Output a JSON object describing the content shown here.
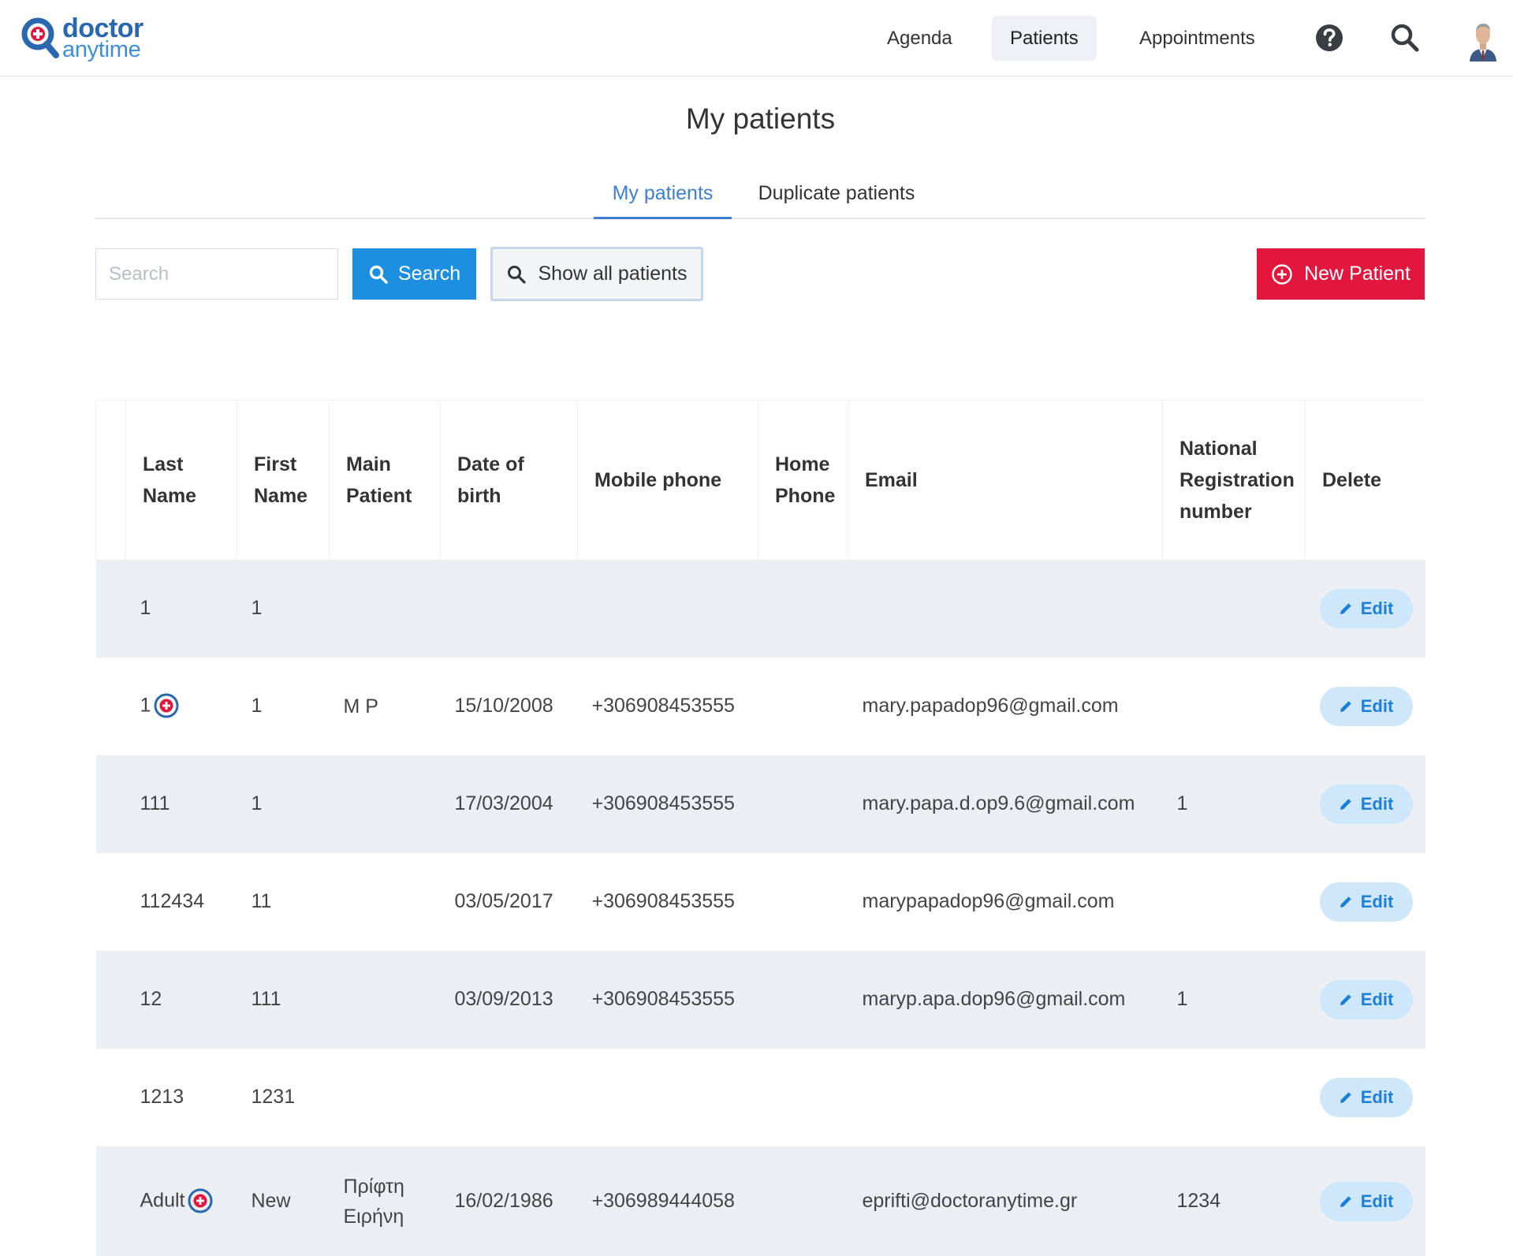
{
  "app": {
    "logo_word1": "doctor",
    "logo_word2": "anytime"
  },
  "nav": {
    "agenda": "Agenda",
    "patients": "Patients",
    "appointments": "Appointments",
    "active": "Patients"
  },
  "page": {
    "title": "My patients"
  },
  "tabs": [
    {
      "label": "My patients",
      "active": true
    },
    {
      "label": "Duplicate patients",
      "active": false
    }
  ],
  "toolbar": {
    "search_placeholder": "Search",
    "search_value": "",
    "search_label": "Search",
    "show_all_label": "Show all patients",
    "new_patient_label": "New Patient"
  },
  "table": {
    "headers": {
      "last_name": "Last Name",
      "first_name": "First Name",
      "main_patient": "Main Patient",
      "dob": "Date of birth",
      "mobile": "Mobile phone",
      "home": "Home Phone",
      "email": "Email",
      "national": "National Registration number",
      "delete": "Delete"
    },
    "edit_label": "Edit",
    "rows": [
      {
        "last": "1",
        "main_badge": false,
        "first": "1",
        "main_patient": "",
        "dob": "",
        "mobile": "",
        "home": "",
        "email": "",
        "national": ""
      },
      {
        "last": "1",
        "main_badge": true,
        "first": "1",
        "main_patient": "M P",
        "dob": "15/10/2008",
        "mobile": "+306908453555",
        "home": "",
        "email": "mary.papadop96@gmail.com",
        "national": ""
      },
      {
        "last": "111",
        "main_badge": false,
        "first": "1",
        "main_patient": "",
        "dob": "17/03/2004",
        "mobile": "+306908453555",
        "home": "",
        "email": "mary.papa.d.op9.6@gmail.com",
        "national": "1"
      },
      {
        "last": "112434",
        "main_badge": false,
        "first": "11",
        "main_patient": "",
        "dob": "03/05/2017",
        "mobile": "+306908453555",
        "home": "",
        "email": "marypapadop96@gmail.com",
        "national": ""
      },
      {
        "last": "12",
        "main_badge": false,
        "first": "111",
        "main_patient": "",
        "dob": "03/09/2013",
        "mobile": "+306908453555",
        "home": "",
        "email": "maryp.apa.dop96@gmail.com",
        "national": "1"
      },
      {
        "last": "1213",
        "main_badge": false,
        "first": "1231",
        "main_patient": "",
        "dob": "",
        "mobile": "",
        "home": "",
        "email": "",
        "national": ""
      },
      {
        "last": "Adult",
        "main_badge": true,
        "first": "New",
        "main_patient": "Πρίφτη Ειρήνη",
        "dob": "16/02/1986",
        "mobile": "+306989444058",
        "home": "",
        "email": "eprifti@doctoranytime.gr",
        "national": "1234"
      }
    ]
  },
  "colors": {
    "brand_blue": "#2a67b1",
    "primary_button": "#1d8fe0",
    "danger_button": "#e3173e",
    "active_tab": "#3d7fd1",
    "row_shade": "#ebeef2",
    "edit_pill_bg": "#cfe7fa",
    "edit_pill_text": "#1d7fd8"
  },
  "icons": {
    "logo": "doctor-anytime-logo-icon",
    "help": "question-circle-icon",
    "search": "magnifier-icon",
    "new": "plus-circle-icon",
    "edit": "pencil-icon",
    "main_patient": "main-patient-badge-icon"
  }
}
